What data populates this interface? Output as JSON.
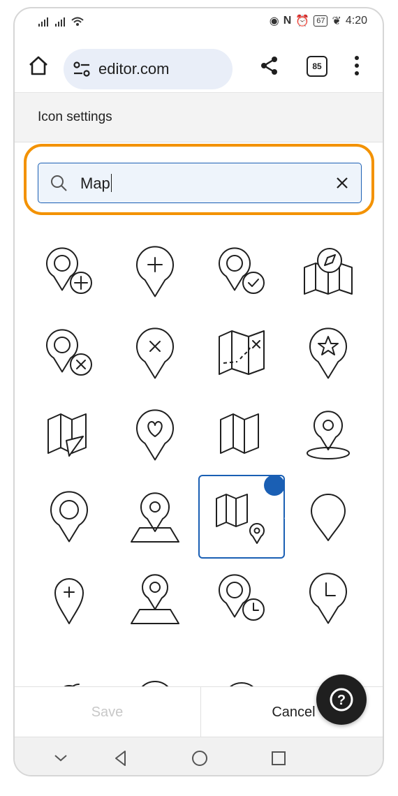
{
  "status_bar": {
    "left_icons": "signal-icons",
    "time": "4:20",
    "battery": "67"
  },
  "browser": {
    "url": "editor.com",
    "tab_count": "85"
  },
  "header": {
    "title": "Icon settings"
  },
  "search": {
    "value": "Map"
  },
  "icons": [
    {
      "name": "location-add-icon"
    },
    {
      "name": "pin-plus-icon"
    },
    {
      "name": "location-check-icon"
    },
    {
      "name": "map-compass-icon"
    },
    {
      "name": "location-remove-icon"
    },
    {
      "name": "pin-x-icon"
    },
    {
      "name": "treasure-map-icon"
    },
    {
      "name": "pin-star-icon"
    },
    {
      "name": "map-navigation-icon"
    },
    {
      "name": "pin-heart-icon"
    },
    {
      "name": "folded-map-icon"
    },
    {
      "name": "pin-ground-icon"
    },
    {
      "name": "pin-circle-icon"
    },
    {
      "name": "pin-on-map-icon"
    },
    {
      "name": "map-with-pin-icon",
      "selected": true
    },
    {
      "name": "pin-empty-icon"
    },
    {
      "name": "pin-small-plus-icon"
    },
    {
      "name": "pin-platform-icon"
    },
    {
      "name": "location-time-icon"
    },
    {
      "name": "pin-clock-icon"
    }
  ],
  "footer": {
    "save_label": "Save",
    "cancel_label": "Cancel"
  },
  "help": {
    "label": "?"
  },
  "colors": {
    "accent": "#1a5fb4",
    "highlight": "#f39200"
  }
}
